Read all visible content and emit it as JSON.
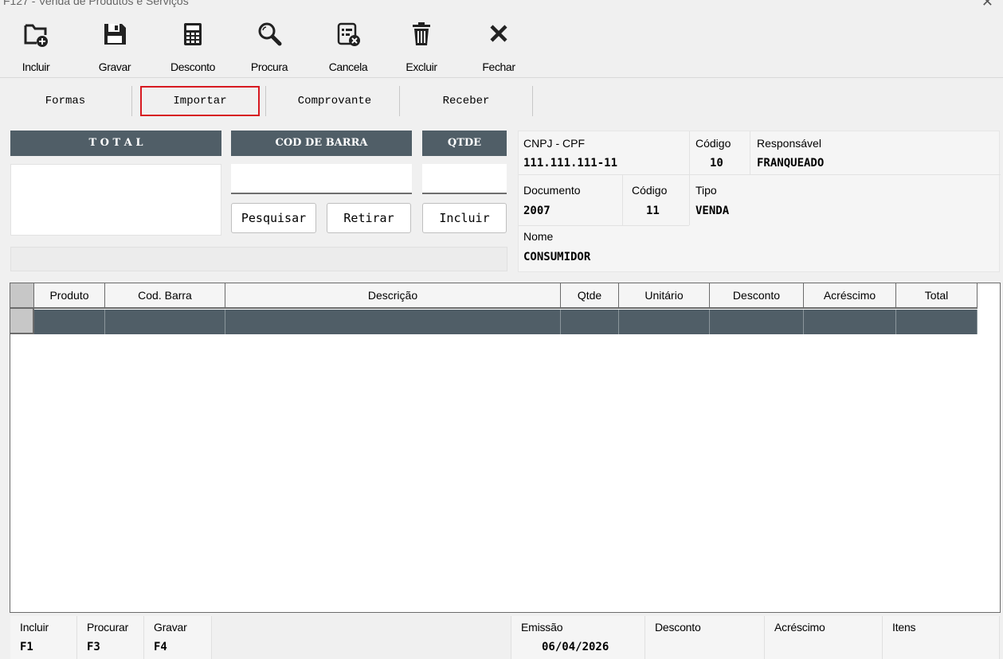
{
  "window": {
    "title": "F127 - Venda de Produtos e Serviços",
    "close_glyph": "✕"
  },
  "toolbar": {
    "incluir": {
      "label": "Incluir",
      "icon": "folder-plus-icon"
    },
    "gravar": {
      "label": "Gravar",
      "icon": "save-icon"
    },
    "desconto": {
      "label": "Desconto",
      "icon": "calculator-icon"
    },
    "procura": {
      "label": "Procura",
      "icon": "search-icon"
    },
    "cancela": {
      "label": "Cancela",
      "icon": "cancel-list-icon"
    },
    "excluir": {
      "label": "Excluir",
      "icon": "trash-icon"
    },
    "fechar": {
      "label": "Fechar",
      "icon": "close-icon"
    }
  },
  "tabs": {
    "formas": "Formas",
    "importar": "Importar",
    "comprovante": "Comprovante",
    "receber": "Receber",
    "active": "importar"
  },
  "entry": {
    "total_header": "T O T A L",
    "barcode_header": "COD DE BARRA",
    "qty_header": "QTDE",
    "total_value": "",
    "barcode_value": "",
    "qty_value": "",
    "btn_pesquisar": "Pesquisar",
    "btn_retirar": "Retirar",
    "btn_incluir": "Incluir"
  },
  "info": {
    "cnpj_label": "CNPJ - CPF",
    "cnpj_value": "111.111.111-11",
    "codigo1_label": "Código",
    "codigo1_value": "10",
    "responsavel_label": "Responsável",
    "responsavel_value": "FRANQUEADO",
    "documento_label": "Documento",
    "documento_value": "2007",
    "codigo2_label": "Código",
    "codigo2_value": "11",
    "tipo_label": "Tipo",
    "tipo_value": "VENDA",
    "nome_label": "Nome",
    "nome_value": "CONSUMIDOR"
  },
  "grid": {
    "columns": [
      "Produto",
      "Cod. Barra",
      "Descrição",
      "Qtde",
      "Unitário",
      "Desconto",
      "Acréscimo",
      "Total"
    ],
    "rows": []
  },
  "statusbar": {
    "incluir_label": "Incluir",
    "incluir_key": "F1",
    "procurar_label": "Procurar",
    "procurar_key": "F3",
    "gravar_label": "Gravar",
    "gravar_key": "F4",
    "emissao_label": "Emissão",
    "emissao_value": "06/04/2026",
    "desconto_label": "Desconto",
    "desconto_value": "",
    "acrescimo_label": "Acréscimo",
    "acrescimo_value": "",
    "itens_label": "Itens",
    "itens_value": ""
  },
  "colors": {
    "header_slate": "#505e67",
    "active_tab_border": "#d71920",
    "background": "#f0f0f0"
  }
}
